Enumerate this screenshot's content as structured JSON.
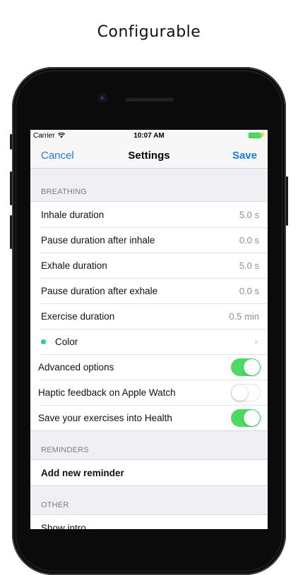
{
  "headline": "Configurable",
  "status_bar": {
    "carrier": "Carrier",
    "time": "10:07 AM"
  },
  "nav": {
    "cancel": "Cancel",
    "title": "Settings",
    "save": "Save"
  },
  "sections": {
    "breathing": {
      "header": "BREATHING",
      "rows": [
        {
          "label": "Inhale duration",
          "value": "5.0 s"
        },
        {
          "label": "Pause duration after inhale",
          "value": "0.0 s"
        },
        {
          "label": "Exhale duration",
          "value": "5.0 s"
        },
        {
          "label": "Pause duration after exhale",
          "value": "0.0 s"
        },
        {
          "label": "Exercise duration",
          "value": "0.5 min"
        }
      ],
      "color_row": {
        "label": "Color",
        "dot_color": "#2fd07a"
      },
      "toggles": [
        {
          "label": "Advanced options",
          "on": true
        },
        {
          "label": "Haptic feedback on Apple Watch",
          "on": false
        },
        {
          "label": "Save your exercises into Health",
          "on": true
        }
      ]
    },
    "reminders": {
      "header": "REMINDERS",
      "add_label": "Add new reminder"
    },
    "other": {
      "header": "OTHER",
      "show_intro": "Show intro"
    }
  },
  "colors": {
    "accent": "#1a7bd8",
    "switch_on": "#4cd964"
  }
}
